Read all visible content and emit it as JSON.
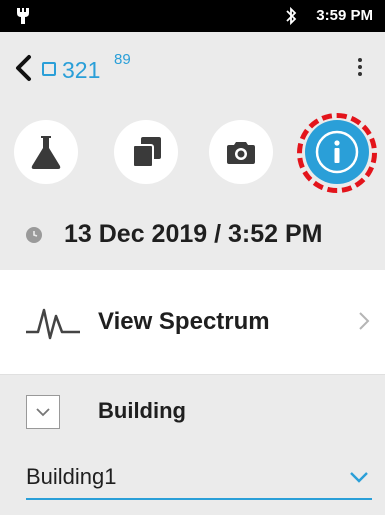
{
  "status_bar": {
    "time": "3:59 PM"
  },
  "toolbar": {
    "sample_number": "321",
    "sample_superscript": "89"
  },
  "actions": [
    {
      "icon": "flask-icon"
    },
    {
      "icon": "copy-icon"
    },
    {
      "icon": "camera-icon"
    },
    {
      "icon": "info-icon"
    }
  ],
  "measurement": {
    "datetime": "13 Dec 2019 / 3:52 PM"
  },
  "spectrum": {
    "label": "View Spectrum"
  },
  "building": {
    "label": "Building",
    "selected": "Building1"
  },
  "colors": {
    "accent": "#2a9fd8",
    "highlight": "#e3141b",
    "panel": "#ebebeb"
  }
}
